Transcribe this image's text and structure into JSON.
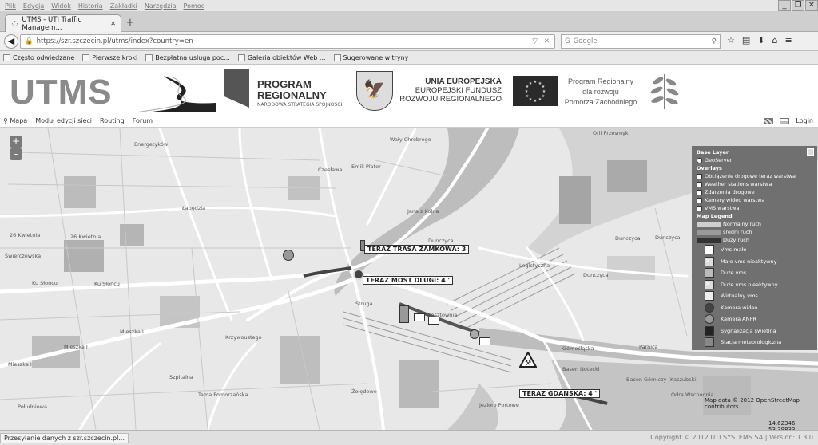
{
  "browser": {
    "menu": [
      "Plik",
      "Edycja",
      "Widok",
      "Historia",
      "Zakładki",
      "Narzędzia",
      "Pomoc"
    ],
    "tab_title": "UTMS - UTI Traffic Managem...",
    "url": "https://szr.szczecin.pl/utms/index?country=en",
    "search_placeholder": "Google",
    "bookmarks": [
      "Często odwiedzane",
      "Pierwsze kroki",
      "Bezpłatna usługa poc...",
      "Galeria obiektów Web ...",
      "Sugerowane witryny"
    ]
  },
  "header": {
    "utms": "UTMS",
    "pr_line1": "PROGRAM",
    "pr_line2": "REGIONALNY",
    "pr_sub": "NARODOWA STRATEGIA SPÓJNOŚCI",
    "ue_line1": "UNIA EUROPEJSKA",
    "ue_line2": "EUROPEJSKI FUNDUSZ",
    "ue_line3": "ROZWOJU REGIONALNEGO",
    "prp_line1": "Program Regionalny",
    "prp_line2": "dla rozwoju",
    "prp_line3": "Pomorza Zachodniego"
  },
  "nav": {
    "mapa": "Mapa",
    "modul": "Moduł edycji sieci",
    "routing": "Routing",
    "forum": "Forum",
    "login": "Login"
  },
  "map": {
    "zoom_in": "+",
    "zoom_out": "-",
    "popups": {
      "zamkowa": "TERAZ TRASA ZAMKOWA: 3",
      "most": "TERAZ MOST DLUGI: 4 '",
      "gdanska": "TERAZ GDANSKA: 4 '"
    },
    "streets": {
      "s1": "Orli Przesmyk",
      "s2": "Dunczyca",
      "s3": "Dunczyca",
      "s4": "Dunczyca",
      "s5": "Dunczyca",
      "s6": "26 Kwietnia",
      "s7": "26 Kwietnia",
      "s8": "Świerczewska",
      "s9": "Ku Słońcu",
      "s10": "Ku Słońcu",
      "s11": "Mieszka I",
      "s12": "Mieszka I",
      "s13": "Mieszka I",
      "s14": "Basen Notecki",
      "s15": "Basen Górniczy (Kaszubski)",
      "s16": "Odra Wschodnia",
      "s17": "Jezioro Portowe",
      "s18": "Parnica",
      "s19": "Gómośląska",
      "s20": "Łasztownia",
      "s21": "Czesława",
      "s22": "Emili Plater",
      "s23": "Południowa",
      "s24": "Struga",
      "s25": "Szpitalna",
      "s26": "Żołędowe",
      "s27": "Energetyków",
      "s28": "Logistyczna",
      "s29": "Wały Chrobrego",
      "s30": "Jana z Kolna",
      "s31": "Tama Pomorzańska",
      "s32": "Krzywoustego",
      "s33": "Łabędzia"
    },
    "attribution": "Map data © 2012 OpenStreetMap contributors",
    "coords": "14.62346, 53.39833"
  },
  "legend": {
    "base_layer": "Base Layer",
    "geoserver": "GeoServer",
    "overlays": "Overlays",
    "ov1": "Obciążenie drogowe teraz warstwa",
    "ov2": "Weather stations warstwa",
    "ov3": "Zdarzenia drogowe",
    "ov4": "Kamery wideo warstwa",
    "ov5": "VMS warstwa",
    "map_legend": "Map Legend",
    "normal": "Normalny ruch",
    "medium": "średni ruch",
    "heavy": "Duży ruch",
    "items": [
      "Vms małe",
      "Małe vms nieaktywny",
      "Duże vms",
      "Duże vms nieaktywny",
      "Wirtualny vms",
      "Kamera wideo",
      "Kamera ANPR",
      "Sygnalizacja świetlna",
      "Stacja meteorologiczna"
    ],
    "colors": {
      "normal": "#cfcfcf",
      "medium": "#9a9a9a",
      "heavy": "#333333"
    }
  },
  "status": {
    "left": "Przesyłanie danych z szr.szczecin.pl...",
    "right": "Copyright © 2012 UTI SYSTEMS SA | Version: 1.3.0"
  }
}
